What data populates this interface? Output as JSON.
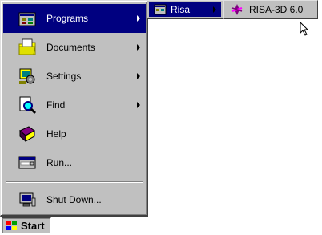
{
  "start_menu": {
    "items": [
      {
        "label": "Programs",
        "icon": "programs-icon",
        "has_submenu": true
      },
      {
        "label": "Documents",
        "icon": "documents-icon",
        "has_submenu": true
      },
      {
        "label": "Settings",
        "icon": "settings-icon",
        "has_submenu": true
      },
      {
        "label": "Find",
        "icon": "find-icon",
        "has_submenu": true
      },
      {
        "label": "Help",
        "icon": "help-icon",
        "has_submenu": false
      },
      {
        "label": "Run...",
        "icon": "run-icon",
        "has_submenu": false
      },
      {
        "label": "Shut Down...",
        "icon": "shutdown-icon",
        "has_submenu": false
      }
    ]
  },
  "submenu": {
    "label": "Risa",
    "icon": "program-group-icon"
  },
  "submenu2": {
    "label": "RISA-3D 6.0",
    "icon": "risa-app-icon"
  },
  "taskbar": {
    "start_label": "Start"
  },
  "colors": {
    "highlight": "#000080",
    "face": "#c0c0c0"
  }
}
